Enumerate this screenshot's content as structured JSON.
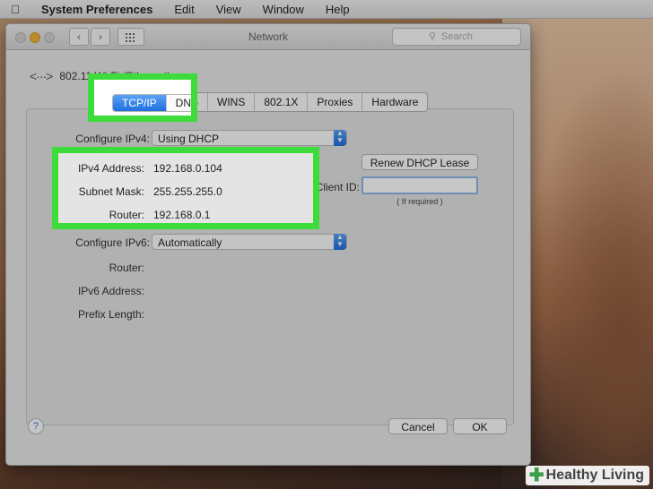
{
  "menubar": {
    "apple": "",
    "items": [
      "System Preferences",
      "Edit",
      "View",
      "Window",
      "Help"
    ]
  },
  "window": {
    "title": "Network",
    "search_placeholder": "Search",
    "network_name": "802.11 Wi-Fi (Ethernet)"
  },
  "tabs": [
    "TCP/IP",
    "DNS",
    "WINS",
    "802.1X",
    "Proxies",
    "Hardware"
  ],
  "active_tab": "TCP/IP",
  "ipv4": {
    "configure_label": "Configure IPv4:",
    "configure_value": "Using DHCP",
    "address_label": "IPv4 Address:",
    "address_value": "192.168.0.104",
    "mask_label": "Subnet Mask:",
    "mask_value": "255.255.255.0",
    "router_label": "Router:",
    "router_value": "192.168.0.1",
    "renew_button": "Renew DHCP Lease",
    "client_id_label": "DHCP Client ID:",
    "client_id_value": "",
    "if_required": "( If required )"
  },
  "ipv6": {
    "configure_label": "Configure IPv6:",
    "configure_value": "Automatically",
    "router_label": "Router:",
    "address_label": "IPv6 Address:",
    "prefix_label": "Prefix Length:"
  },
  "footer": {
    "help": "?",
    "cancel": "Cancel",
    "ok": "OK"
  },
  "watermark": {
    "text": "Healthy Living"
  },
  "colors": {
    "highlight": "#3ddc3a",
    "accent": "#1f6fe0"
  }
}
